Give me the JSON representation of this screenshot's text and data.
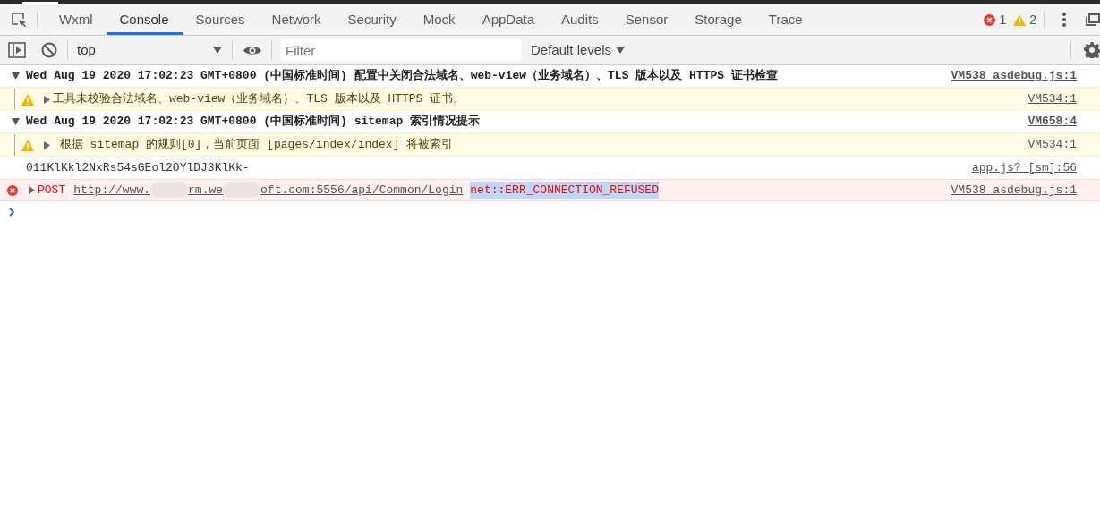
{
  "tabs": [
    {
      "label": "Wxml",
      "selected": false
    },
    {
      "label": "Console",
      "selected": true
    },
    {
      "label": "Sources",
      "selected": false
    },
    {
      "label": "Network",
      "selected": false
    },
    {
      "label": "Security",
      "selected": false
    },
    {
      "label": "Mock",
      "selected": false
    },
    {
      "label": "AppData",
      "selected": false
    },
    {
      "label": "Audits",
      "selected": false
    },
    {
      "label": "Sensor",
      "selected": false
    },
    {
      "label": "Storage",
      "selected": false
    },
    {
      "label": "Trace",
      "selected": false
    }
  ],
  "counts": {
    "errors": "1",
    "warnings": "2"
  },
  "toolbar": {
    "context": "top",
    "filter_placeholder": "Filter",
    "levels": "Default levels"
  },
  "messages": [
    {
      "kind": "group",
      "expanded": true,
      "text": "Wed Aug 19 2020 17:02:23 GMT+0800 (中国标准时间) 配置中关闭合法域名、web-view（业务域名）、TLS 版本以及 HTTPS 证书检查",
      "source": "VM538 asdebug.js:1"
    },
    {
      "kind": "warning",
      "expanded": false,
      "text": "工具未校验合法域名、web-view（业务域名）、TLS 版本以及 HTTPS 证书。",
      "source": "VM534:1"
    },
    {
      "kind": "group",
      "expanded": true,
      "text": "Wed Aug 19 2020 17:02:23 GMT+0800 (中国标准时间) sitemap 索引情况提示",
      "source": "VM658:4"
    },
    {
      "kind": "warning",
      "expanded": false,
      "text": " 根据 sitemap 的规则[0]，当前页面 [pages/index/index] 将被索引",
      "source": "VM534:1"
    },
    {
      "kind": "log",
      "text": "011KlKkl2NxRs54sGEol2OYlDJ3KlKk-",
      "source": "app.js? [sm]:56"
    },
    {
      "kind": "error",
      "expanded": false,
      "method": "POST",
      "url_parts": [
        "http://www.",
        "rm.we",
        "oft.com:5556/api/Common/Login"
      ],
      "text": "net::ERR_CONNECTION_REFUSED",
      "source": "VM538 asdebug.js:1"
    }
  ]
}
